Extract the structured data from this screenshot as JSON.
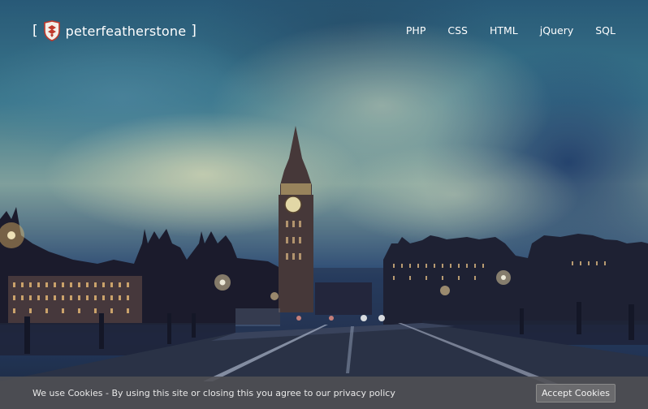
{
  "brand": {
    "open_bracket": "[",
    "name": "peterfeatherstone",
    "close_bracket": "]",
    "logo_icon": "shield-crest-icon"
  },
  "nav": {
    "items": [
      {
        "label": "PHP"
      },
      {
        "label": "CSS"
      },
      {
        "label": "HTML"
      },
      {
        "label": "jQuery"
      },
      {
        "label": "SQL"
      }
    ]
  },
  "cookie_bar": {
    "message": "We use Cookies - By using this site or closing this you agree to our privacy policy",
    "button_label": "Accept Cookies"
  },
  "colors": {
    "text": "#ffffff",
    "cookie_bar_bg": "#505054",
    "logo_red": "#c0392b"
  }
}
